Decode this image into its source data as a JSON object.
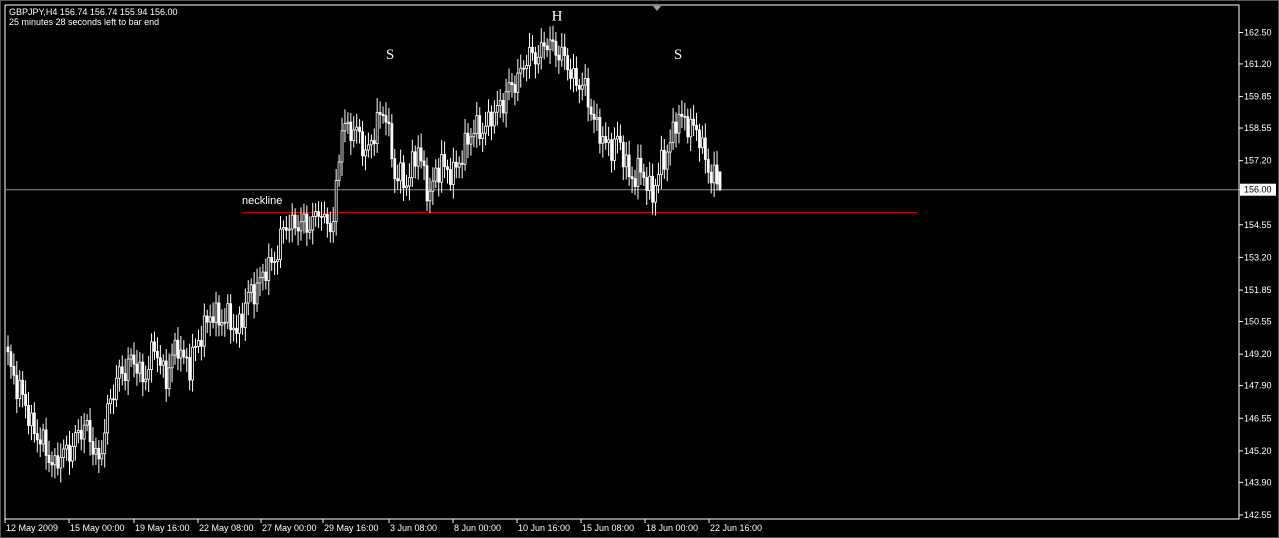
{
  "header": {
    "symbol_line": "GBPJPY,H4  156.74 156.74 155.94 156.00",
    "timer_line": "25 minutes 28 seconds left to bar end"
  },
  "colors": {
    "background": "#000000",
    "candle": "#ffffff",
    "bid_line": "#8a8fa8",
    "neckline": "#e00000",
    "text": "#ffffff"
  },
  "chart_data": {
    "type": "candlestick",
    "symbol": "GBPJPY",
    "timeframe": "H4",
    "ohlc_current": {
      "open": 156.74,
      "high": 156.74,
      "low": 155.94,
      "close": 156.0
    },
    "current_price": 156.0,
    "current_price_label": "156.00",
    "ylim": [
      142.55,
      162.55
    ],
    "y_ticks": [
      "162.50",
      "161.20",
      "159.85",
      "158.55",
      "157.20",
      "156.00",
      "154.55",
      "153.20",
      "151.85",
      "150.55",
      "149.20",
      "147.90",
      "146.55",
      "145.20",
      "143.90",
      "142.55"
    ],
    "x_tick_labels": [
      "12 May 2009",
      "15 May 00:00",
      "19 May 16:00",
      "22 May 08:00",
      "27 May 00:00",
      "29 May 16:00",
      "3 Jun 08:00",
      "8 Jun 00:00",
      "10 Jun 16:00",
      "15 Jun 08:00",
      "18 Jun 00:00",
      "22 Jun 16:00"
    ],
    "annotations": [
      {
        "text": "S",
        "price": 161.4,
        "date": "3 Jun 08:00"
      },
      {
        "text": "H",
        "price": 163.0,
        "date": "10 Jun 16:00"
      },
      {
        "text": "S",
        "price": 161.4,
        "date": "18 Jun 16:00"
      },
      {
        "text": "neckline",
        "price": 155.4,
        "date": "22 May 16:00"
      }
    ],
    "neckline": {
      "label": "neckline",
      "price": 155.05
    },
    "path_anchors": [
      {
        "i": 0,
        "p": 149.0
      },
      {
        "i": 6,
        "p": 147.0
      },
      {
        "i": 10,
        "p": 145.8
      },
      {
        "i": 16,
        "p": 144.6
      },
      {
        "i": 22,
        "p": 145.5
      },
      {
        "i": 27,
        "p": 146.3
      },
      {
        "i": 31,
        "p": 144.5
      },
      {
        "i": 34,
        "p": 147.0
      },
      {
        "i": 38,
        "p": 148.3
      },
      {
        "i": 42,
        "p": 149.0
      },
      {
        "i": 46,
        "p": 148.2
      },
      {
        "i": 50,
        "p": 149.4
      },
      {
        "i": 54,
        "p": 148.3
      },
      {
        "i": 58,
        "p": 149.6
      },
      {
        "i": 62,
        "p": 148.6
      },
      {
        "i": 66,
        "p": 150.2
      },
      {
        "i": 70,
        "p": 150.8
      },
      {
        "i": 74,
        "p": 150.7
      },
      {
        "i": 78,
        "p": 150.2
      },
      {
        "i": 82,
        "p": 151.5
      },
      {
        "i": 86,
        "p": 152.3
      },
      {
        "i": 90,
        "p": 152.9
      },
      {
        "i": 94,
        "p": 154.3
      },
      {
        "i": 98,
        "p": 154.7
      },
      {
        "i": 102,
        "p": 154.4
      },
      {
        "i": 106,
        "p": 155.2
      },
      {
        "i": 108,
        "p": 154.5
      },
      {
        "i": 111,
        "p": 154.8
      },
      {
        "i": 114,
        "p": 158.5
      },
      {
        "i": 118,
        "p": 158.6
      },
      {
        "i": 122,
        "p": 157.5
      },
      {
        "i": 126,
        "p": 158.7
      },
      {
        "i": 129,
        "p": 159.3
      },
      {
        "i": 132,
        "p": 156.5
      },
      {
        "i": 136,
        "p": 156.4
      },
      {
        "i": 140,
        "p": 157.6
      },
      {
        "i": 144,
        "p": 155.8
      },
      {
        "i": 148,
        "p": 157.2
      },
      {
        "i": 152,
        "p": 156.5
      },
      {
        "i": 156,
        "p": 157.9
      },
      {
        "i": 160,
        "p": 158.5
      },
      {
        "i": 164,
        "p": 158.7
      },
      {
        "i": 168,
        "p": 159.6
      },
      {
        "i": 172,
        "p": 160.2
      },
      {
        "i": 176,
        "p": 161.2
      },
      {
        "i": 180,
        "p": 161.6
      },
      {
        "i": 184,
        "p": 162.0
      },
      {
        "i": 188,
        "p": 161.8
      },
      {
        "i": 192,
        "p": 160.8
      },
      {
        "i": 196,
        "p": 160.3
      },
      {
        "i": 200,
        "p": 159.0
      },
      {
        "i": 204,
        "p": 157.7
      },
      {
        "i": 208,
        "p": 158.1
      },
      {
        "i": 212,
        "p": 156.6
      },
      {
        "i": 216,
        "p": 156.7
      },
      {
        "i": 220,
        "p": 155.9
      },
      {
        "i": 224,
        "p": 157.3
      },
      {
        "i": 228,
        "p": 158.8
      },
      {
        "i": 232,
        "p": 158.9
      },
      {
        "i": 236,
        "p": 158.1
      },
      {
        "i": 240,
        "p": 156.6
      },
      {
        "i": 243,
        "p": 156.0
      }
    ]
  }
}
